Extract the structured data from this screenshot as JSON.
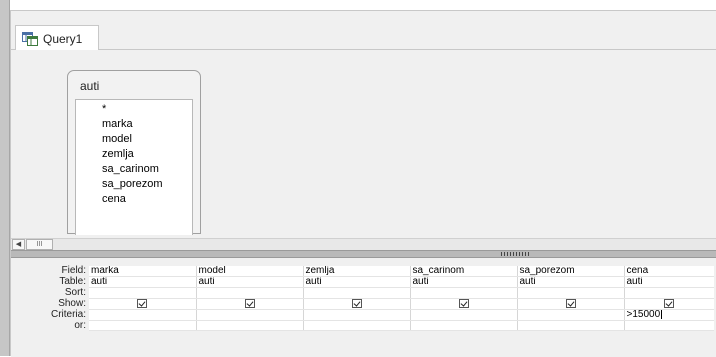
{
  "document_tab": {
    "label": "Query1",
    "icon": "query-design-icon"
  },
  "table_box": {
    "title": "auti",
    "fields": [
      "*",
      "marka",
      "model",
      "zemlja",
      "sa_carinom",
      "sa_porezom",
      "cena"
    ]
  },
  "scrollbar": {
    "left_arrow": "◀",
    "thumb_grip": "III"
  },
  "grid": {
    "row_labels": {
      "field": "Field:",
      "table": "Table:",
      "sort": "Sort:",
      "show": "Show:",
      "criteria": "Criteria:",
      "or": "or:"
    },
    "columns": [
      {
        "field": "marka",
        "table": "auti",
        "show": true,
        "criteria": ""
      },
      {
        "field": "model",
        "table": "auti",
        "show": true,
        "criteria": ""
      },
      {
        "field": "zemlja",
        "table": "auti",
        "show": true,
        "criteria": ""
      },
      {
        "field": "sa_carinom",
        "table": "auti",
        "show": true,
        "criteria": ""
      },
      {
        "field": "sa_porezom",
        "table": "auti",
        "show": true,
        "criteria": ""
      },
      {
        "field": "cena",
        "table": "auti",
        "show": true,
        "criteria": ">15000"
      }
    ]
  }
}
